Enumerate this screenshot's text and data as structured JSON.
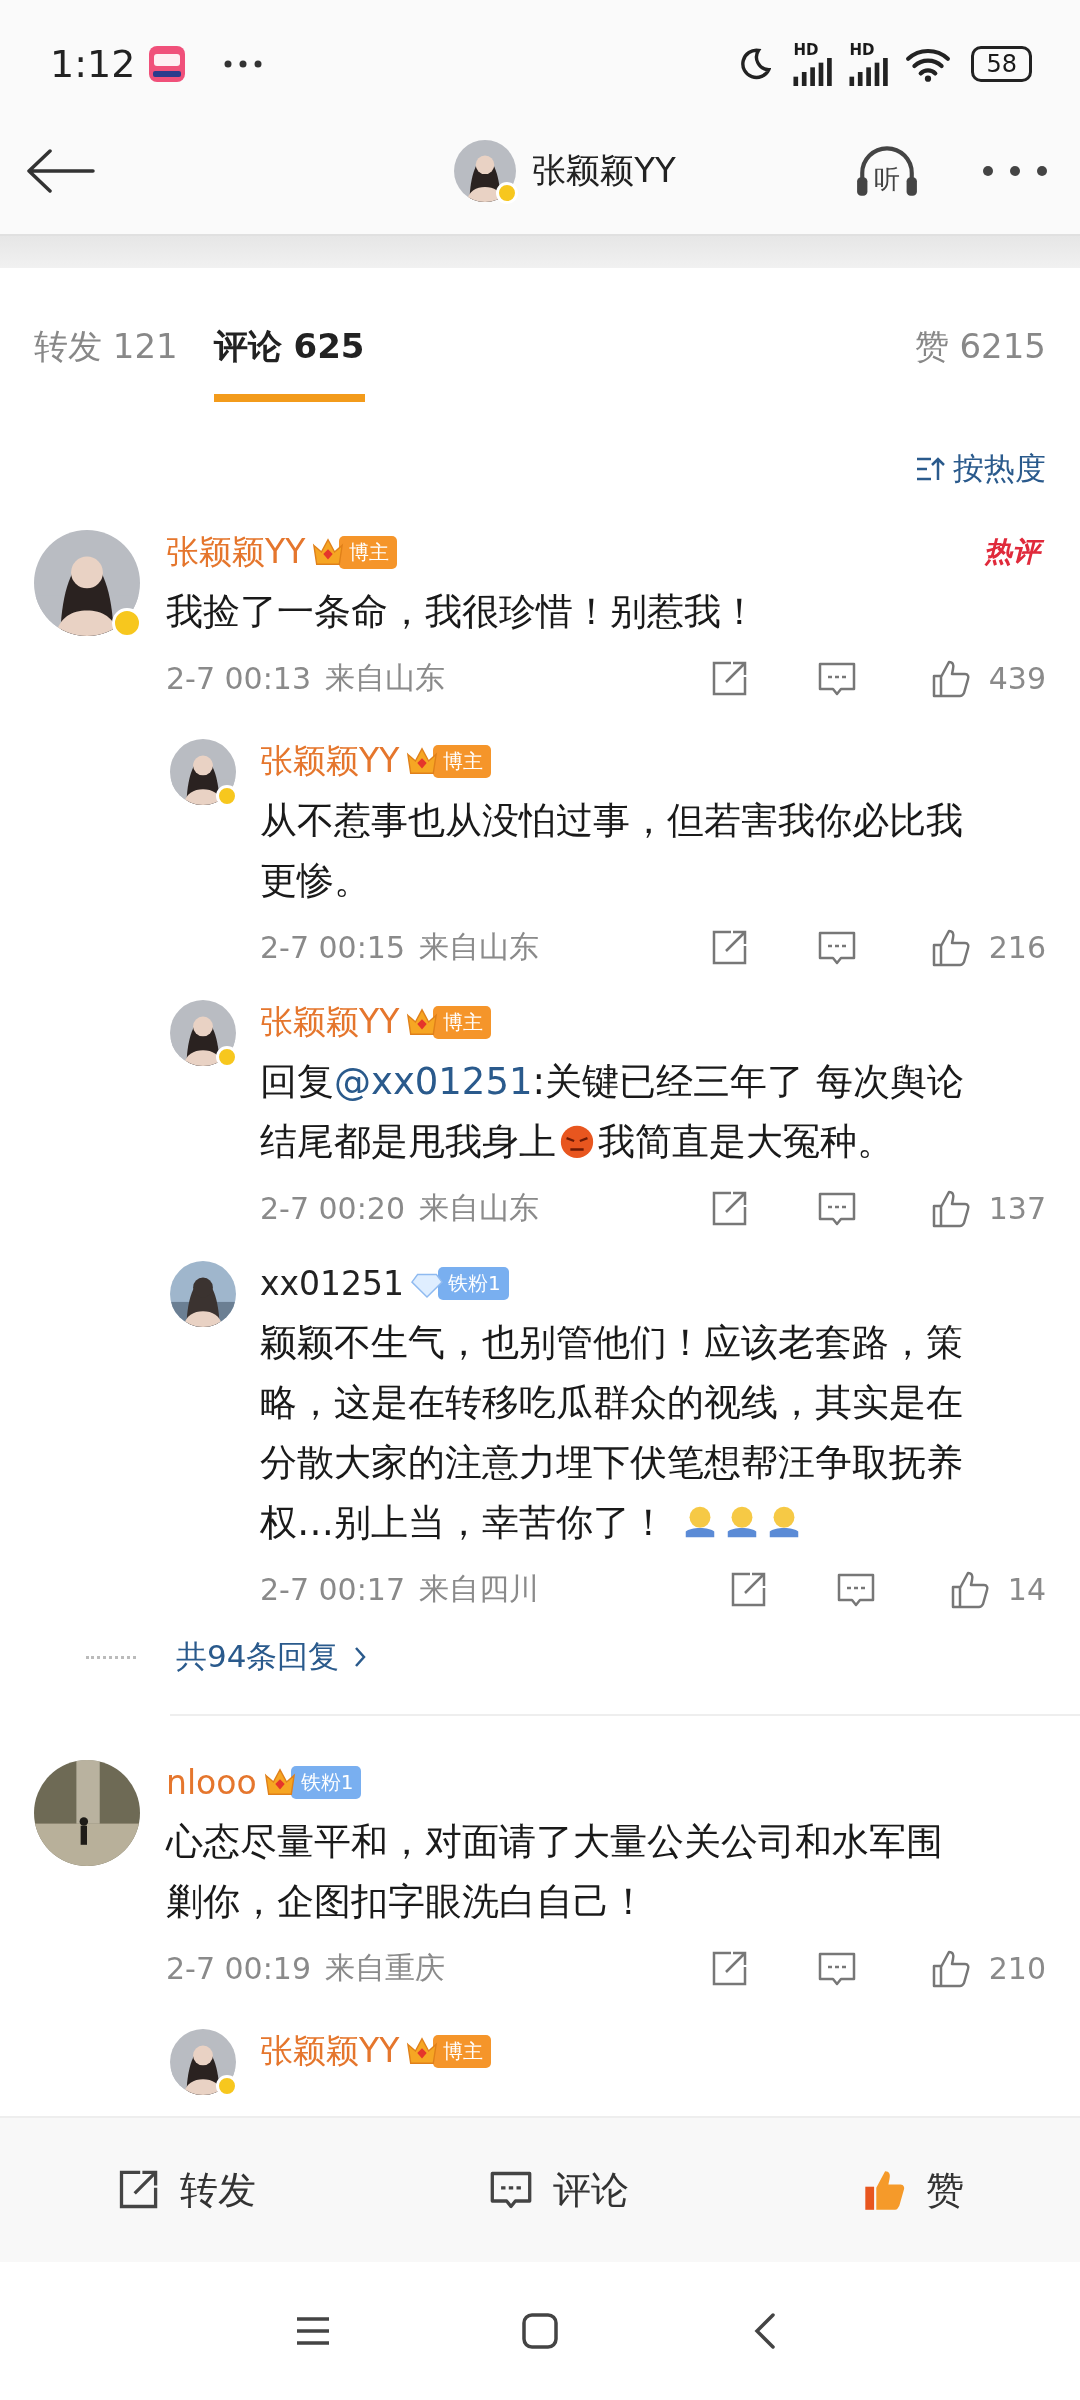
{
  "status_bar": {
    "time": "1:12",
    "signals": [
      "HD",
      "HD"
    ],
    "battery": "58"
  },
  "header": {
    "title": "张颖颖YY",
    "listen_label": "听"
  },
  "tabs": [
    {
      "label": "转发",
      "count": "121",
      "selected": false
    },
    {
      "label": "评论",
      "count": "625",
      "selected": true
    }
  ],
  "likes_tab": {
    "label": "赞",
    "count": "6215"
  },
  "sort": {
    "label": "按热度"
  },
  "comments": [
    {
      "name": "张颖颖YY",
      "vip": true,
      "verified": true,
      "badge": {
        "kind": "crown",
        "label": "博主"
      },
      "hot": "热评",
      "parts": [
        {
          "kind": "text",
          "text": "我捡了一条命，我很珍惜！别惹我！"
        }
      ],
      "time": "2-7 00:13",
      "location": "来自山东",
      "likes": "439",
      "replies": [
        {
          "name": "张颖颖YY",
          "vip": true,
          "verified": true,
          "badge": {
            "kind": "crown",
            "label": "博主"
          },
          "parts": [
            {
              "kind": "text",
              "text": "从不惹事也从没怕过事，但若害我你必比我更惨。"
            }
          ],
          "time": "2-7 00:15",
          "location": "来自山东",
          "likes": "216"
        },
        {
          "name": "张颖颖YY",
          "vip": true,
          "verified": true,
          "badge": {
            "kind": "crown",
            "label": "博主"
          },
          "parts": [
            {
              "kind": "text",
              "text": "回复"
            },
            {
              "kind": "mention",
              "text": "@xx01251"
            },
            {
              "kind": "text",
              "text": ":关键已经三年了 每次舆论结尾都是甩我身上"
            },
            {
              "kind": "angry"
            },
            {
              "kind": "text",
              "text": "我简直是大冤种。"
            }
          ],
          "time": "2-7 00:20",
          "location": "来自山东",
          "likes": "137"
        },
        {
          "name": "xx01251",
          "vip": false,
          "verified": false,
          "badge": {
            "kind": "diamond",
            "label": "铁粉1"
          },
          "parts": [
            {
              "kind": "text",
              "text": "颖颖不生气，也别管他们！应该老套路，策略，这是在转移吃瓜群众的视线，其实是在分散大家的注意力埋下伏笔想帮汪争取抚养权…别上当，幸苦你了！ "
            },
            {
              "kind": "hug"
            },
            {
              "kind": "hug"
            },
            {
              "kind": "hug"
            }
          ],
          "time": "2-7 00:17",
          "location": "来自四川",
          "likes": "14"
        }
      ],
      "more_replies": "共94条回复"
    },
    {
      "name": "nlooo",
      "vip": true,
      "verified": false,
      "badge": {
        "kind": "crown_fan",
        "label": "铁粉1"
      },
      "parts": [
        {
          "kind": "text",
          "text": "心态尽量平和，对面请了大量公关公司和水军围剿你，企图扣字眼洗白自己！"
        }
      ],
      "time": "2-7 00:19",
      "location": "来自重庆",
      "likes": "210",
      "replies": [
        {
          "name": "张颖颖YY",
          "vip": true,
          "verified": true,
          "badge": {
            "kind": "crown",
            "label": "博主"
          }
        }
      ]
    }
  ],
  "actions": [
    {
      "kind": "repost",
      "label": "转发"
    },
    {
      "kind": "comment",
      "label": "评论"
    },
    {
      "kind": "like",
      "label": "赞"
    }
  ]
}
